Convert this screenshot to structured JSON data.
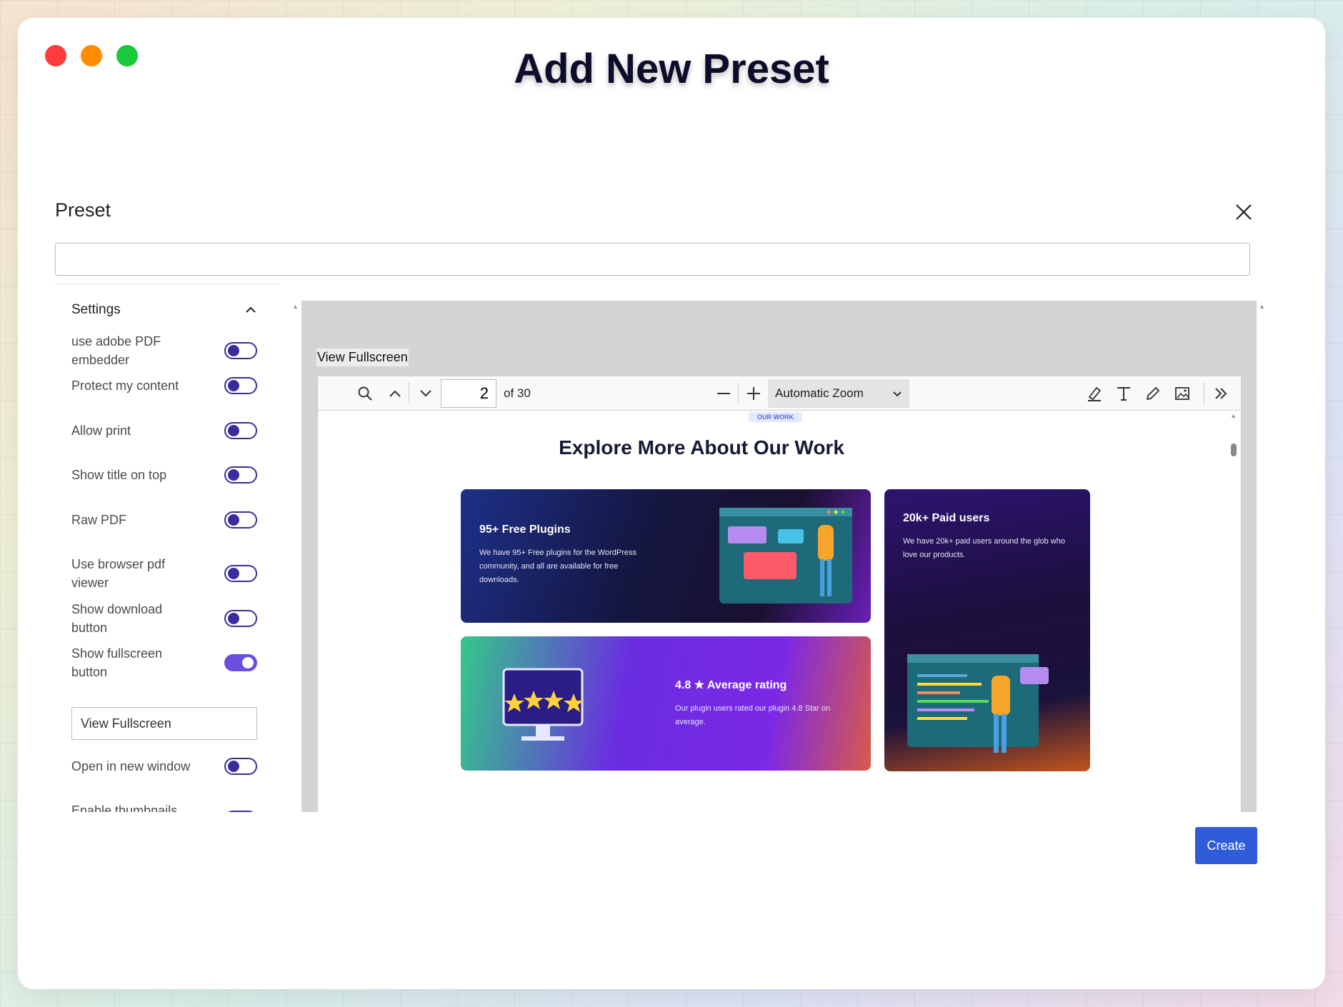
{
  "app": {
    "title": "Add New Preset"
  },
  "dialog": {
    "preset_label": "Preset",
    "preset_input_value": "",
    "create_label": "Create"
  },
  "settings": {
    "heading": "Settings",
    "items": [
      {
        "label": "use adobe PDF embedder",
        "enabled": false
      },
      {
        "label": "Protect my content",
        "enabled": false
      },
      {
        "label": "Allow print",
        "enabled": false
      },
      {
        "label": "Show title on top",
        "enabled": false
      },
      {
        "label": "Raw PDF",
        "enabled": false
      },
      {
        "label": "Use browser pdf viewer",
        "enabled": false
      },
      {
        "label": "Show download button",
        "enabled": false
      },
      {
        "label": "Show fullscreen button",
        "enabled": true
      },
      {
        "label": "Open in new window",
        "enabled": false
      },
      {
        "label": "Enable thumbnails",
        "enabled": false
      }
    ],
    "fullscreen_text_value": "View Fullscreen"
  },
  "preview": {
    "view_fullscreen_label": "View Fullscreen",
    "toolbar": {
      "page_value": "2",
      "page_total": "of 30",
      "zoom_value": "Automatic Zoom"
    },
    "document": {
      "badge": "OUR WORK",
      "title": "Explore More About Our Work",
      "cards": [
        {
          "title": "95+ Free Plugins",
          "text": "We have 95+ Free plugins for the WordPress community, and all are available for free downloads."
        },
        {
          "title": "20k+ Paid users",
          "text": "We have 20k+ paid users around the glob who love our products."
        },
        {
          "title": "4.8 ★ Average rating",
          "text": "Our plugin users rated our plugin 4.8 Star on average."
        }
      ]
    }
  },
  "icons": {
    "search": "search-icon",
    "prev_page": "chevron-up-icon",
    "next_page": "chevron-down-icon",
    "zoom_out": "minus-icon",
    "zoom_in": "plus-icon",
    "highlight": "highlighter-icon",
    "text": "text-icon",
    "draw": "pencil-icon",
    "image": "image-icon",
    "more_tools": "double-chevron-right-icon",
    "close": "close-icon"
  },
  "colors": {
    "toggle_on": "#6b4fe0",
    "toggle_off_border": "#3a2c9c",
    "primary_button": "#2f5cd8"
  }
}
